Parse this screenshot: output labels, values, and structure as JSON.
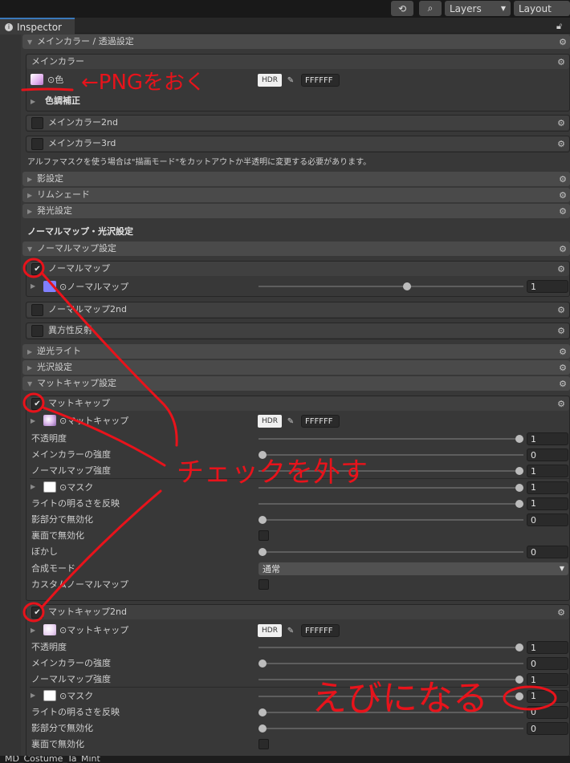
{
  "topbar": {
    "history_icon": "history-icon",
    "search_icon": "search-icon",
    "layers_label": "Layers",
    "layout_label": "Layout"
  },
  "tab": {
    "label": "Inspector",
    "lock_icon": "lock-icon",
    "info_icon": "info-icon"
  },
  "sections": {
    "main_color_transparency": "メインカラー / 透過設定",
    "main_color": "メインカラー",
    "color_field_label": "⊙色",
    "hdr": "HDR",
    "main_hex": "FFFFFF",
    "tone_correction": "色調補正",
    "main_color_2nd": "メインカラー2nd",
    "main_color_3rd": "メインカラー3rd",
    "alpha_mask_note": "アルファマスクを使う場合は\"描画モード\"をカットアウトか半透明に変更する必要があります。",
    "shadow_settings": "影設定",
    "rim_shade": "リムシェード",
    "emission_settings": "発光設定",
    "normal_gloss_heading": "ノーマルマップ・光沢設定",
    "normal_map_settings": "ノーマルマップ設定",
    "normal_map": "ノーマルマップ",
    "normal_map_tex": "⊙ノーマルマップ",
    "normal_map_value": "1",
    "normal_map_2nd": "ノーマルマップ2nd",
    "anisotropy": "異方性反射",
    "backlight": "逆光ライト",
    "gloss_settings": "光沢設定",
    "matcap_settings": "マットキャップ設定",
    "matcap": "マットキャップ",
    "matcap_tex": "⊙マットキャップ",
    "matcap_hex": "FFFFFF",
    "matcap_2nd": "マットキャップ2nd",
    "matcap2_tex": "⊙マットキャップ",
    "matcap2_hex": "FFFFFF"
  },
  "matcap_rows": [
    {
      "label": "不透明度",
      "value": "1",
      "level": 1
    },
    {
      "label": "メインカラーの強度",
      "value": "0",
      "level": 0
    },
    {
      "label": "ノーマルマップ強度",
      "value": "1",
      "level": 1
    },
    {
      "label": "⊙マスク",
      "value": "1",
      "level": 1
    },
    {
      "label": "ライトの明るさを反映",
      "value": "1",
      "level": 1
    },
    {
      "label": "影部分で無効化",
      "value": "0",
      "level": 0
    },
    {
      "label": "裏面で無効化"
    },
    {
      "label": "ぼかし",
      "value": "0",
      "level": 0
    },
    {
      "label": "合成モード",
      "option": "通常"
    },
    {
      "label": "カスタムノーマルマップ"
    }
  ],
  "matcap2_rows": [
    {
      "label": "不透明度",
      "value": "1",
      "level": 1
    },
    {
      "label": "メインカラーの強度",
      "value": "0",
      "level": 0
    },
    {
      "label": "ノーマルマップ強度",
      "value": "1",
      "level": 1
    },
    {
      "label": "⊙マスク",
      "value": "1",
      "level": 1
    },
    {
      "label": "ライトの明るさを反映",
      "value": "0",
      "level": 0
    },
    {
      "label": "影部分で無効化",
      "value": "0",
      "level": 0
    },
    {
      "label": "裏面で無効化"
    }
  ],
  "normal_map_level": 0.5,
  "bottom_label": "MD_Costume_Ta_Mint",
  "annotations": {
    "png": "←PNGをおく",
    "uncheck": "チェックを外す",
    "ebi": "えびになる"
  },
  "colors": {
    "annotation": "#e8131b",
    "accent": "#3a79bb",
    "normal_map_thumb": "#8080ff"
  }
}
